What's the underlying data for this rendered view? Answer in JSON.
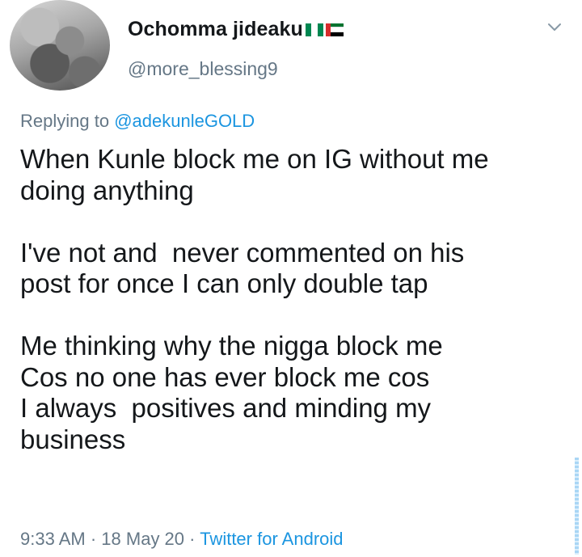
{
  "tweet": {
    "author": {
      "display_name": "Ochomma jideaku",
      "handle": "@more_blessing9",
      "flags": [
        "nigeria-flag",
        "uae-flag"
      ]
    },
    "more_icon": "chevron-down-icon",
    "replying_to": {
      "prefix": "Replying to",
      "mention": "@adekunleGOLD"
    },
    "text": "When Kunle block me on IG without me\ndoing anything\n\nI've not and  never commented on his\npost for once I can only double tap\n\nMe thinking why the nigga block me\nCos no one has ever block me cos\nI always  positives and minding my\nbusiness",
    "meta": {
      "time": "9:33 AM",
      "separator": "·",
      "date": "18 May 20",
      "source": "Twitter for Android"
    }
  },
  "colors": {
    "text_primary": "#14171a",
    "text_secondary": "#657786",
    "link": "#1b95e0"
  }
}
